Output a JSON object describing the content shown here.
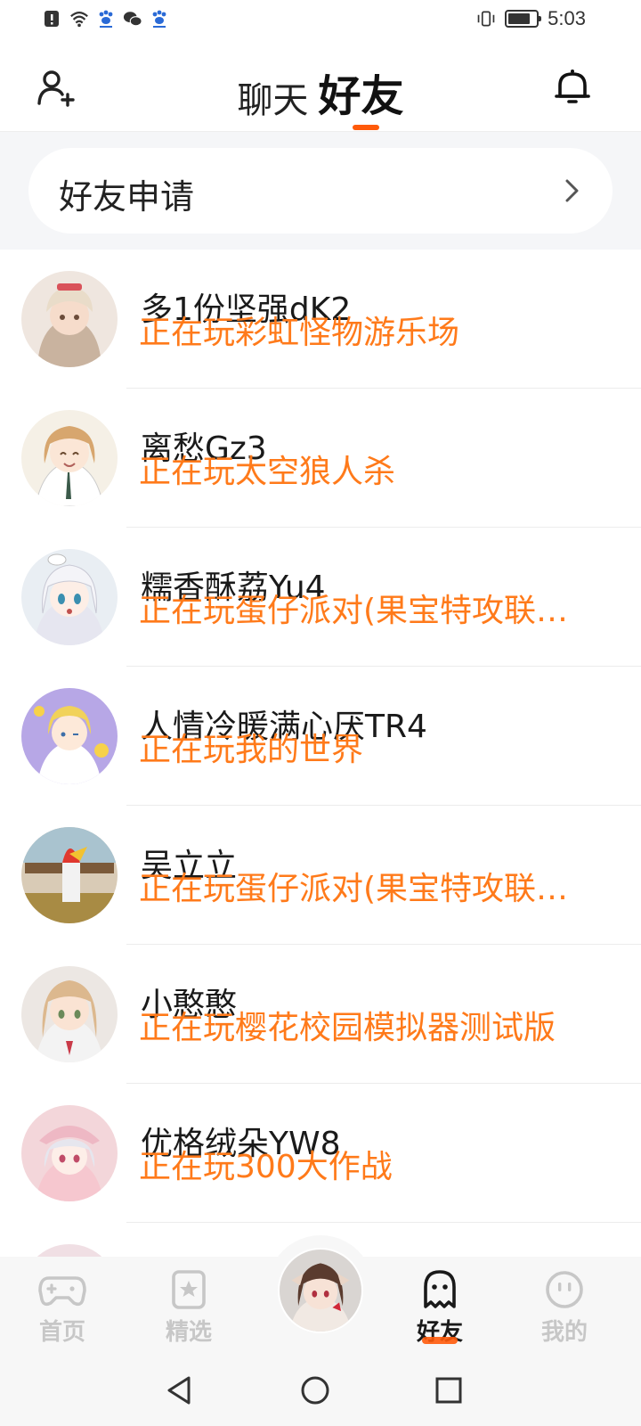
{
  "status_bar": {
    "time": "5:03",
    "battery_level": 0.7
  },
  "header": {
    "tab_chat": "聊天",
    "tab_friends": "好友",
    "active_tab": "好友",
    "accent": "#ff5a0a"
  },
  "friend_request": {
    "label": "好友申请"
  },
  "friends": [
    {
      "name": "多1份坚强dK2",
      "status": "正在玩彩虹怪物游乐场"
    },
    {
      "name": "离愁Gz3",
      "status": "正在玩太空狼人杀"
    },
    {
      "name": "糯香酥荔Yu4",
      "status": "正在玩蛋仔派对(果宝特攻联…"
    },
    {
      "name": "人情冷暖满心厌TR4",
      "status": "正在玩我的世界"
    },
    {
      "name": "吴立立",
      "status": "正在玩蛋仔派对(果宝特攻联…"
    },
    {
      "name": "小憨憨",
      "status": "正在玩樱花校园模拟器测试版"
    },
    {
      "name": "优格绒朵YW8",
      "status": "正在玩300大作战"
    }
  ],
  "bottom_nav": {
    "home": "首页",
    "featured": "精选",
    "friends": "好友",
    "mine": "我的",
    "active": "好友"
  },
  "colors": {
    "status_text": "#ff7a1a",
    "inactive_nav": "#c7c7c7"
  }
}
